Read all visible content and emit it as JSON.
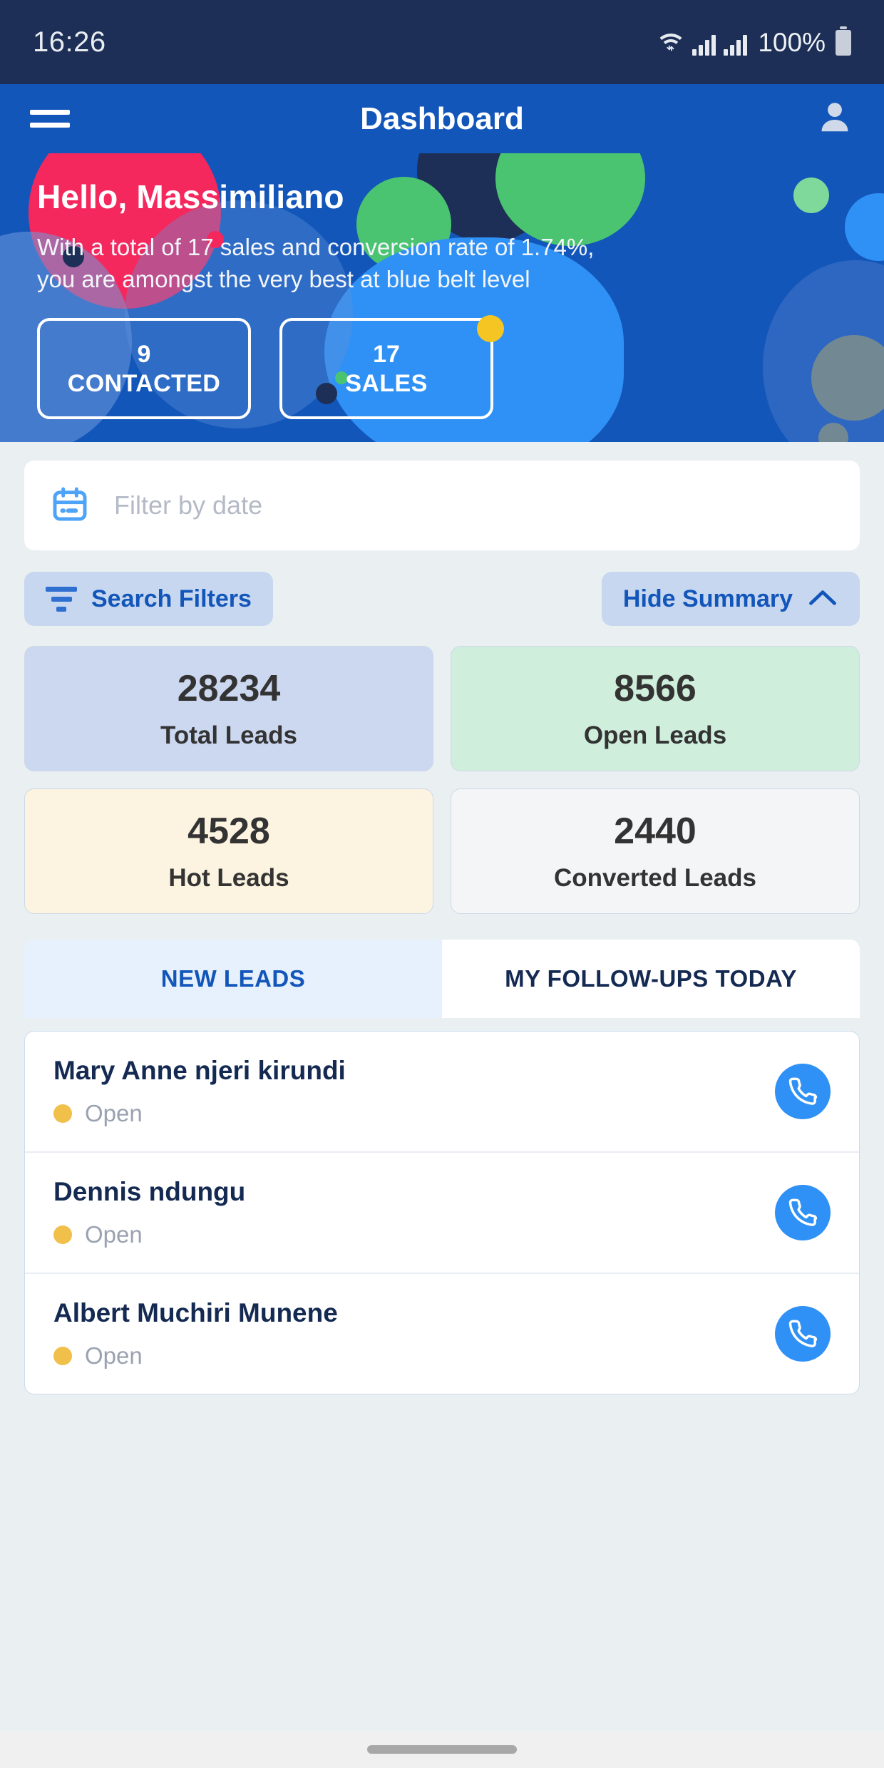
{
  "status_bar": {
    "time": "16:26",
    "battery_percent": "100%",
    "wifi_icon": "wifi-icon",
    "signal_icon": "signal-bars-icon",
    "battery_icon": "battery-icon"
  },
  "app_bar": {
    "title": "Dashboard",
    "menu_icon": "hamburger-menu-icon",
    "profile_icon": "person-avatar-icon"
  },
  "hero": {
    "greeting": "Hello, Massimiliano",
    "subtitle": "With a total of 17 sales and conversion rate of 1.74%, you are amongst the very best at blue belt level",
    "chips": [
      {
        "value": "9",
        "label": "CONTACTED",
        "has_badge": false
      },
      {
        "value": "17",
        "label": "SALES",
        "has_badge": true
      }
    ],
    "background_color": "#1356ba",
    "badge_color": "#f5c523"
  },
  "date_filter": {
    "placeholder": "Filter by date",
    "value": "",
    "icon": "calendar-icon",
    "icon_color": "#4da3f7"
  },
  "filter_row": {
    "search_filters_label": "Search Filters",
    "search_filters_icon": "filter-funnel-icon",
    "hide_summary_label": "Hide Summary",
    "hide_summary_icon": "chevron-up-icon",
    "pill_bg": "#c7d7f0",
    "pill_text_color": "#1356ba"
  },
  "summary_cards": [
    {
      "value": "28234",
      "label": "Total Leads",
      "bg": "#ccd8f0"
    },
    {
      "value": "8566",
      "label": "Open Leads",
      "bg": "#cfeedb"
    },
    {
      "value": "4528",
      "label": "Hot Leads",
      "bg": "#fcf4e0"
    },
    {
      "value": "2440",
      "label": "Converted Leads",
      "bg": "#f4f5f7"
    }
  ],
  "tabs": [
    {
      "label": "NEW LEADS",
      "active": true
    },
    {
      "label": "MY FOLLOW-UPS TODAY",
      "active": false
    }
  ],
  "leads": [
    {
      "name": "Mary Anne njeri kirundi",
      "status": "Open",
      "status_color": "#f0c04a",
      "call_icon": "phone-icon"
    },
    {
      "name": "Dennis ndungu",
      "status": "Open",
      "status_color": "#f0c04a",
      "call_icon": "phone-icon"
    },
    {
      "name": "Albert Muchiri Munene",
      "status": "Open",
      "status_color": "#f0c04a",
      "call_icon": "phone-icon"
    }
  ],
  "nav_bar": {
    "home_indicator": "home-indicator"
  }
}
